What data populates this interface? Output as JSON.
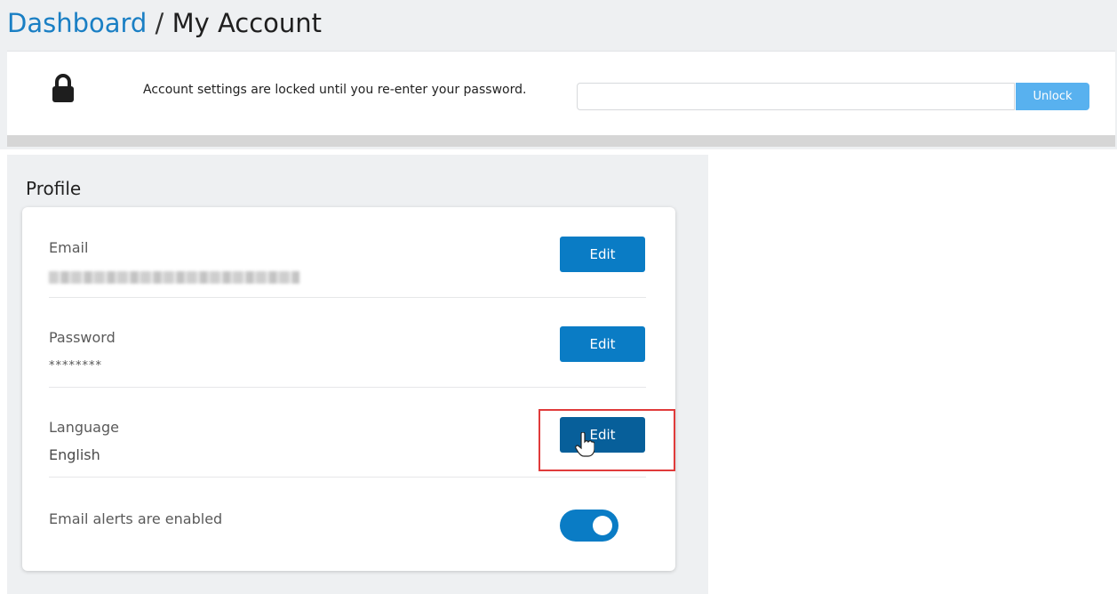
{
  "breadcrumb": {
    "link": "Dashboard",
    "separator": " / ",
    "current": "My Account"
  },
  "lockbar": {
    "icon": "lock-icon",
    "message": "Account settings are locked until you re-enter your password.",
    "password_value": "",
    "unlock_label": "Unlock"
  },
  "profile": {
    "title": "Profile",
    "email": {
      "label": "Email",
      "value_redacted": true,
      "edit_label": "Edit"
    },
    "password": {
      "label": "Password",
      "value": "********",
      "edit_label": "Edit"
    },
    "language": {
      "label": "Language",
      "value": "English",
      "edit_label": "Edit"
    },
    "alerts": {
      "label": "Email alerts are enabled",
      "enabled": true
    }
  },
  "colors": {
    "accent": "#0a7cc5",
    "link": "#1a7fc4",
    "unlock": "#58b1ef",
    "highlight": "#e03b3b",
    "panel_bg": "#eef0f2"
  }
}
